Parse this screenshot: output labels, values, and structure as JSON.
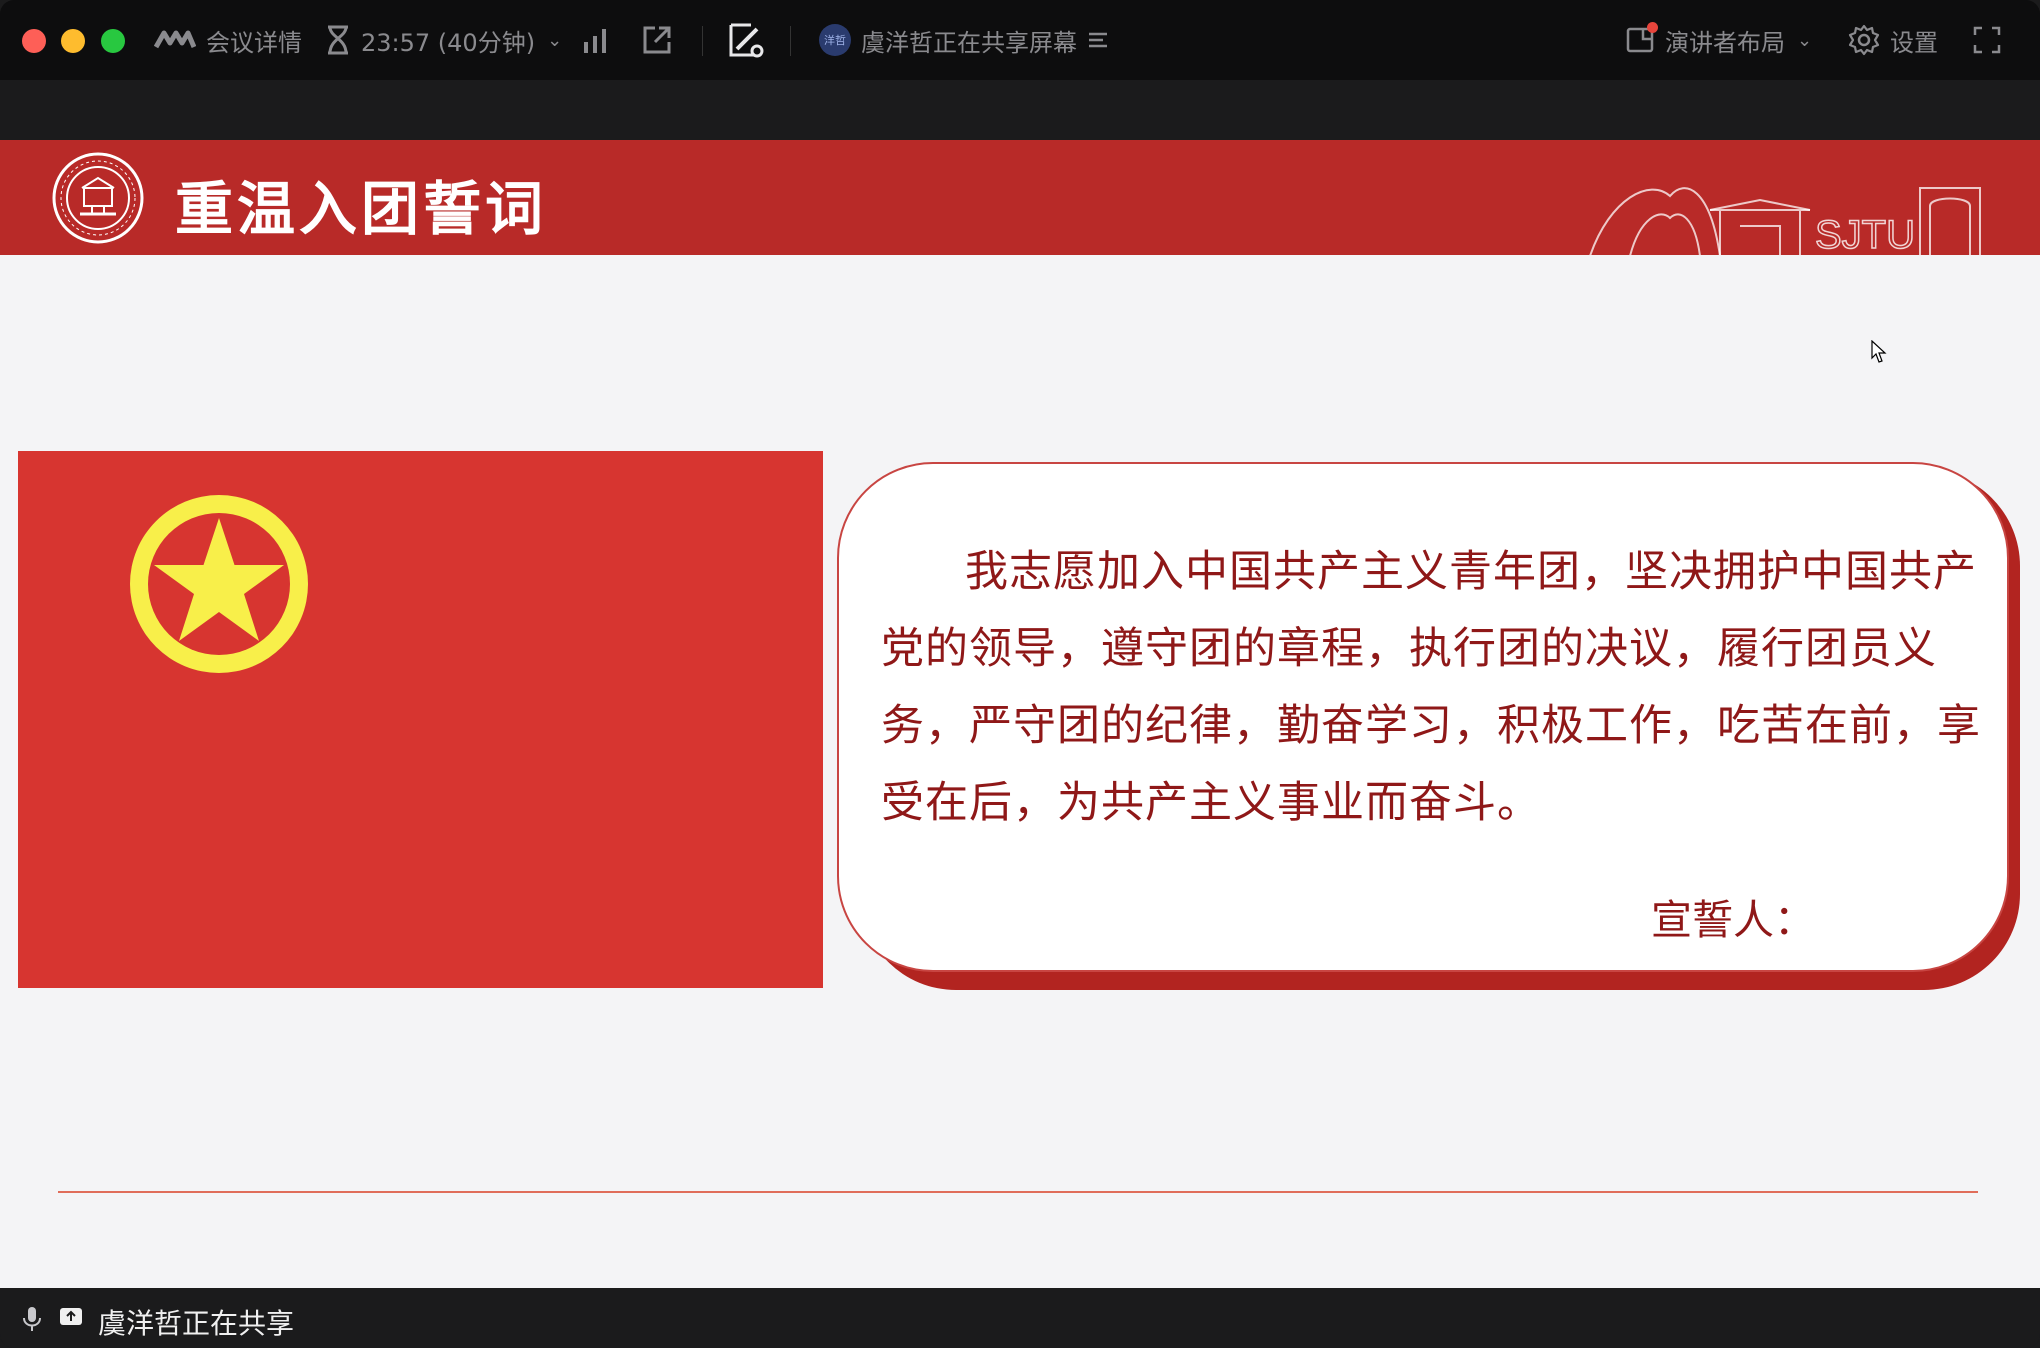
{
  "toolbar": {
    "meeting_details_label": "会议详情",
    "timer_label": "23:57 (40分钟)",
    "sharer_avatar_text": "洋哲",
    "sharing_status": "虞洋哲正在共享屏幕",
    "layout_label": "演讲者布局",
    "settings_label": "设置"
  },
  "slide": {
    "title": "重温入团誓词",
    "campus_mark": "SJTU",
    "oath_text": "我志愿加入中国共产主义青年团，坚决拥护中国共产党的领导，遵守团的章程，执行团的决议，履行团员义务，严守团的纪律，勤奋学习，积极工作，吃苦在前，享受在后，为共产主义事业而奋斗。",
    "signer_label": "宣誓人："
  },
  "bottombar": {
    "sharing_text": "虞洋哲正在共享"
  },
  "colors": {
    "header_red": "#b82a28",
    "flag_red": "#d73530",
    "emblem_yellow": "#f8ef4a",
    "oath_text": "#8f1818"
  }
}
